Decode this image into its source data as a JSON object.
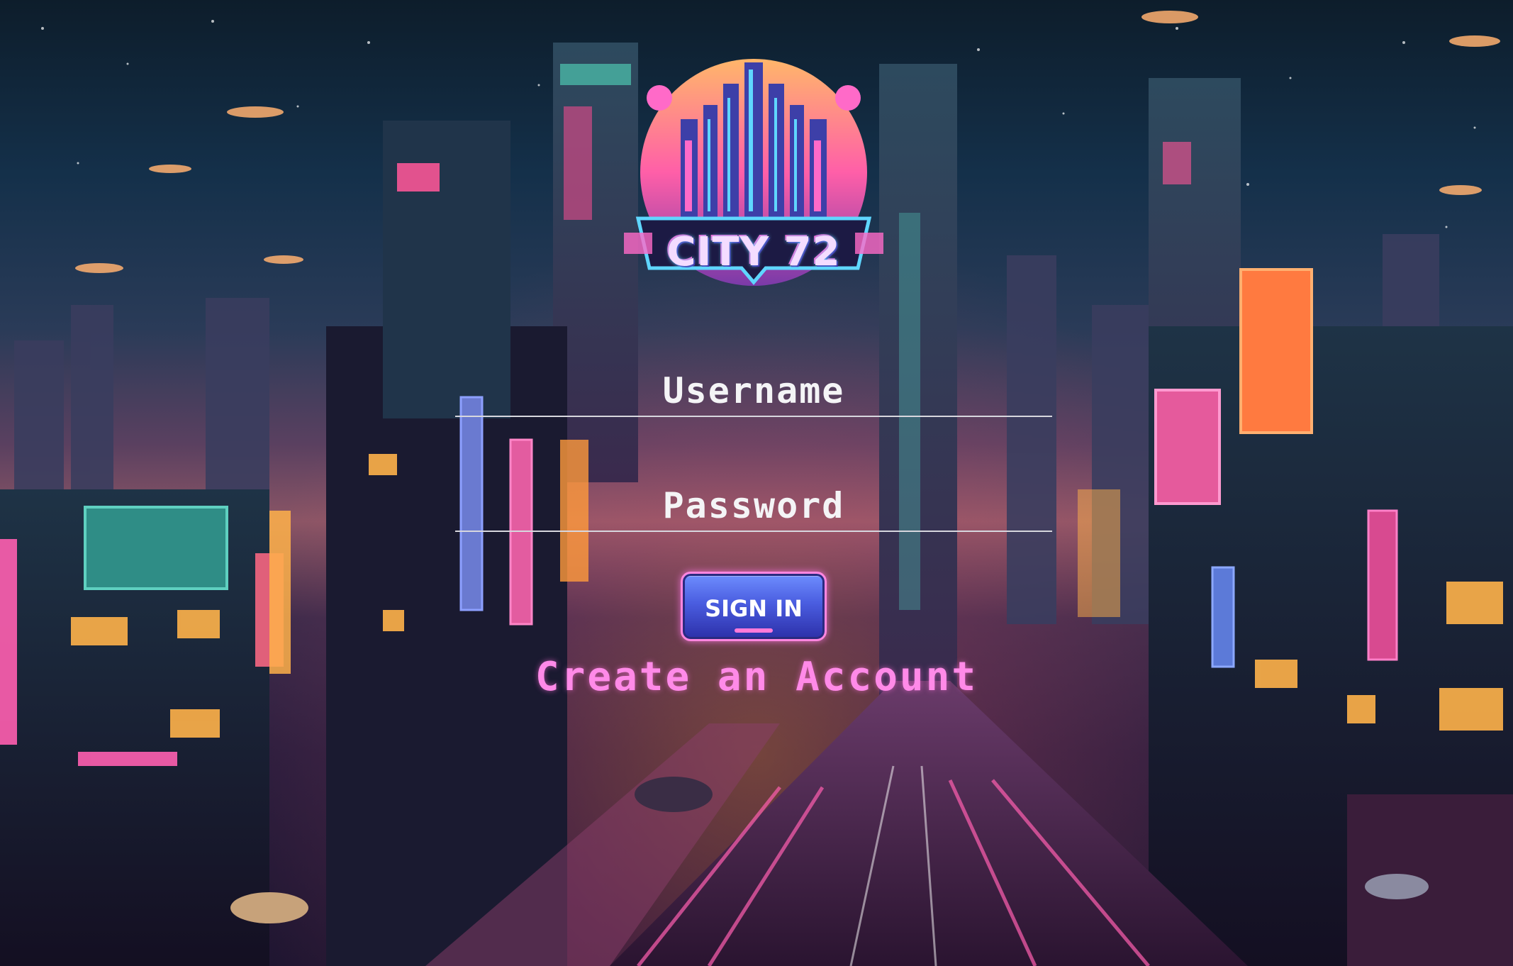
{
  "app": {
    "logo_text": "CITY 72"
  },
  "form": {
    "username_placeholder": "Username",
    "password_placeholder": "Password",
    "sign_in_label": "SIGN IN",
    "create_account_label": "Create an Account"
  },
  "colors": {
    "accent_pink": "#ff8ae8",
    "button_blue": "#4a5de0",
    "field_line": "#d7d7de",
    "text_white": "#f4f4f6"
  }
}
